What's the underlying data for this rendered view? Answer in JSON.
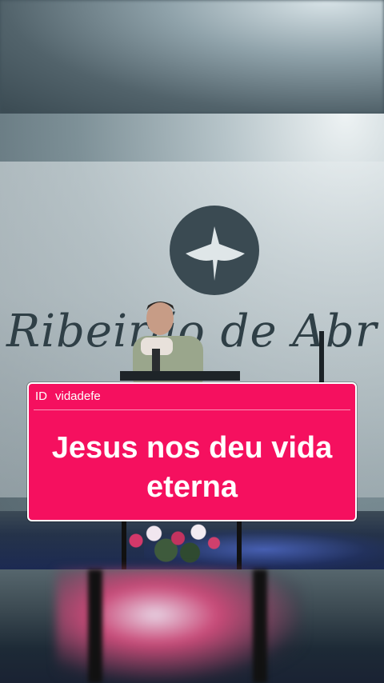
{
  "backdrop": {
    "church_name": "Ribeirão de Abr"
  },
  "caption": {
    "id_label": "ID",
    "handle": "vidadefe",
    "text": "Jesus nos deu vida eterna"
  },
  "colors": {
    "caption_bg": "#f5105f",
    "caption_border": "#ffffff",
    "logo": "#3a4a52"
  },
  "icons": {
    "logo": "dove-logo-icon"
  }
}
